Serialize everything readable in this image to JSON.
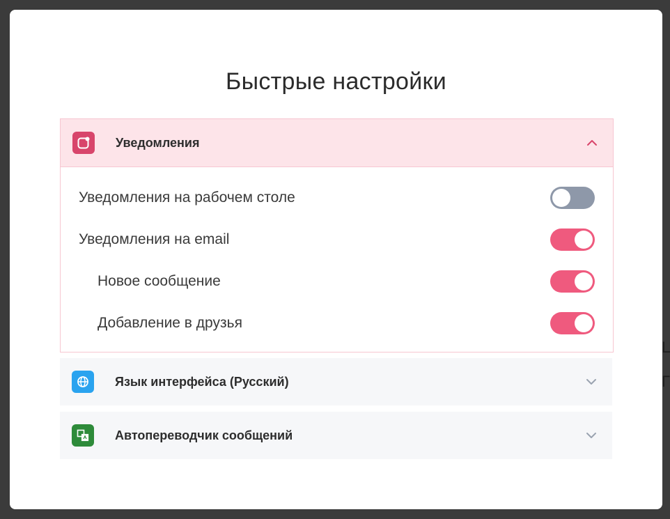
{
  "dialog": {
    "title": "Быстрые настройки"
  },
  "sections": {
    "notifications": {
      "label": "Уведомления",
      "icon": "notification-badge-icon",
      "icon_color": "#d8456b",
      "expanded": true,
      "rows": [
        {
          "label": "Уведомления на рабочем столе",
          "enabled": false,
          "indent": false
        },
        {
          "label": "Уведомления на email",
          "enabled": true,
          "indent": false
        },
        {
          "label": "Новое сообщение",
          "enabled": true,
          "indent": true
        },
        {
          "label": "Добавление в друзья",
          "enabled": true,
          "indent": true
        }
      ]
    },
    "language": {
      "label": "Язык интерфейса (Русский)",
      "icon": "globe-icon",
      "icon_color": "#2aa3ef",
      "expanded": false
    },
    "translator": {
      "label": "Автопереводчик сообщений",
      "icon": "translate-icon",
      "icon_color": "#2e8b3a",
      "expanded": false
    }
  },
  "colors": {
    "accent": "#ef5a7e",
    "toggle_off": "#8e98a9",
    "header_active_bg": "#fde4e9",
    "collapsed_bg": "#f6f7f9"
  }
}
